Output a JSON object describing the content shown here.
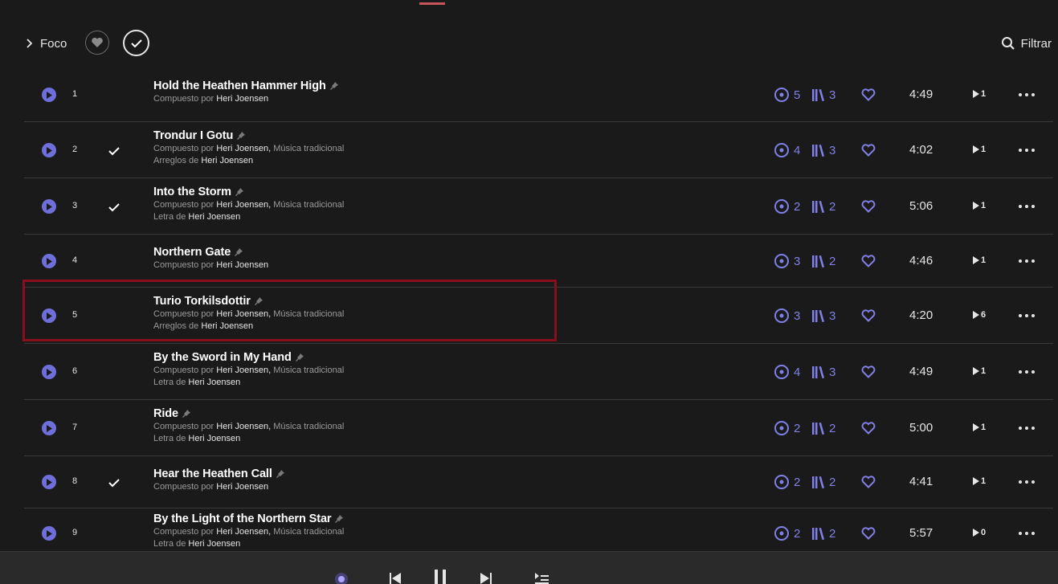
{
  "toolbar": {
    "focus_label": "Foco",
    "filter_label": "Filtrar"
  },
  "tracks": [
    {
      "num": "1",
      "title": "Hold the Heathen Hammer High",
      "checked": false,
      "credits": [
        {
          "label": "Compuesto por ",
          "people": [
            "Heri Joensen"
          ]
        }
      ],
      "plays": "5",
      "albums": "3",
      "duration": "4:49",
      "playcount": "1"
    },
    {
      "num": "2",
      "title": "Trondur I Gotu",
      "checked": true,
      "credits": [
        {
          "label": "Compuesto por ",
          "people": [
            "Heri Joensen",
            "Música tradicional"
          ]
        },
        {
          "label": "Arreglos de ",
          "people": [
            "Heri Joensen"
          ]
        }
      ],
      "plays": "4",
      "albums": "3",
      "duration": "4:02",
      "playcount": "1"
    },
    {
      "num": "3",
      "title": "Into the Storm",
      "checked": true,
      "credits": [
        {
          "label": "Compuesto por ",
          "people": [
            "Heri Joensen",
            "Música tradicional"
          ]
        },
        {
          "label": "Letra de ",
          "people": [
            "Heri Joensen"
          ]
        }
      ],
      "plays": "2",
      "albums": "2",
      "duration": "5:06",
      "playcount": "1"
    },
    {
      "num": "4",
      "title": "Northern Gate",
      "checked": false,
      "credits": [
        {
          "label": "Compuesto por ",
          "people": [
            "Heri Joensen"
          ]
        }
      ],
      "plays": "3",
      "albums": "2",
      "duration": "4:46",
      "playcount": "1"
    },
    {
      "num": "5",
      "title": "Turio Torkilsdottir",
      "checked": false,
      "credits": [
        {
          "label": "Compuesto por ",
          "people": [
            "Heri Joensen",
            "Música tradicional"
          ]
        },
        {
          "label": "Arreglos de ",
          "people": [
            "Heri Joensen"
          ]
        }
      ],
      "plays": "3",
      "albums": "3",
      "duration": "4:20",
      "playcount": "6"
    },
    {
      "num": "6",
      "title": "By the Sword in My Hand",
      "checked": false,
      "credits": [
        {
          "label": "Compuesto por ",
          "people": [
            "Heri Joensen",
            "Música tradicional"
          ]
        },
        {
          "label": "Letra de ",
          "people": [
            "Heri Joensen"
          ]
        }
      ],
      "plays": "4",
      "albums": "3",
      "duration": "4:49",
      "playcount": "1"
    },
    {
      "num": "7",
      "title": "Ride",
      "checked": false,
      "credits": [
        {
          "label": "Compuesto por ",
          "people": [
            "Heri Joensen",
            "Música tradicional"
          ]
        },
        {
          "label": "Letra de ",
          "people": [
            "Heri Joensen"
          ]
        }
      ],
      "plays": "2",
      "albums": "2",
      "duration": "5:00",
      "playcount": "1"
    },
    {
      "num": "8",
      "title": "Hear the Heathen Call",
      "checked": true,
      "credits": [
        {
          "label": "Compuesto por ",
          "people": [
            "Heri Joensen"
          ]
        }
      ],
      "plays": "2",
      "albums": "2",
      "duration": "4:41",
      "playcount": "1"
    },
    {
      "num": "9",
      "title": "By the Light of the Northern Star",
      "checked": false,
      "credits": [
        {
          "label": "Compuesto por ",
          "people": [
            "Heri Joensen",
            "Música tradicional"
          ]
        },
        {
          "label": "Letra de ",
          "people": [
            "Heri Joensen"
          ]
        }
      ],
      "plays": "2",
      "albums": "2",
      "duration": "5:57",
      "playcount": "0"
    }
  ],
  "colors": {
    "accent": "#6f6fdc",
    "highlight_border": "#8a0f1e",
    "active_tab": "#c8555a"
  }
}
